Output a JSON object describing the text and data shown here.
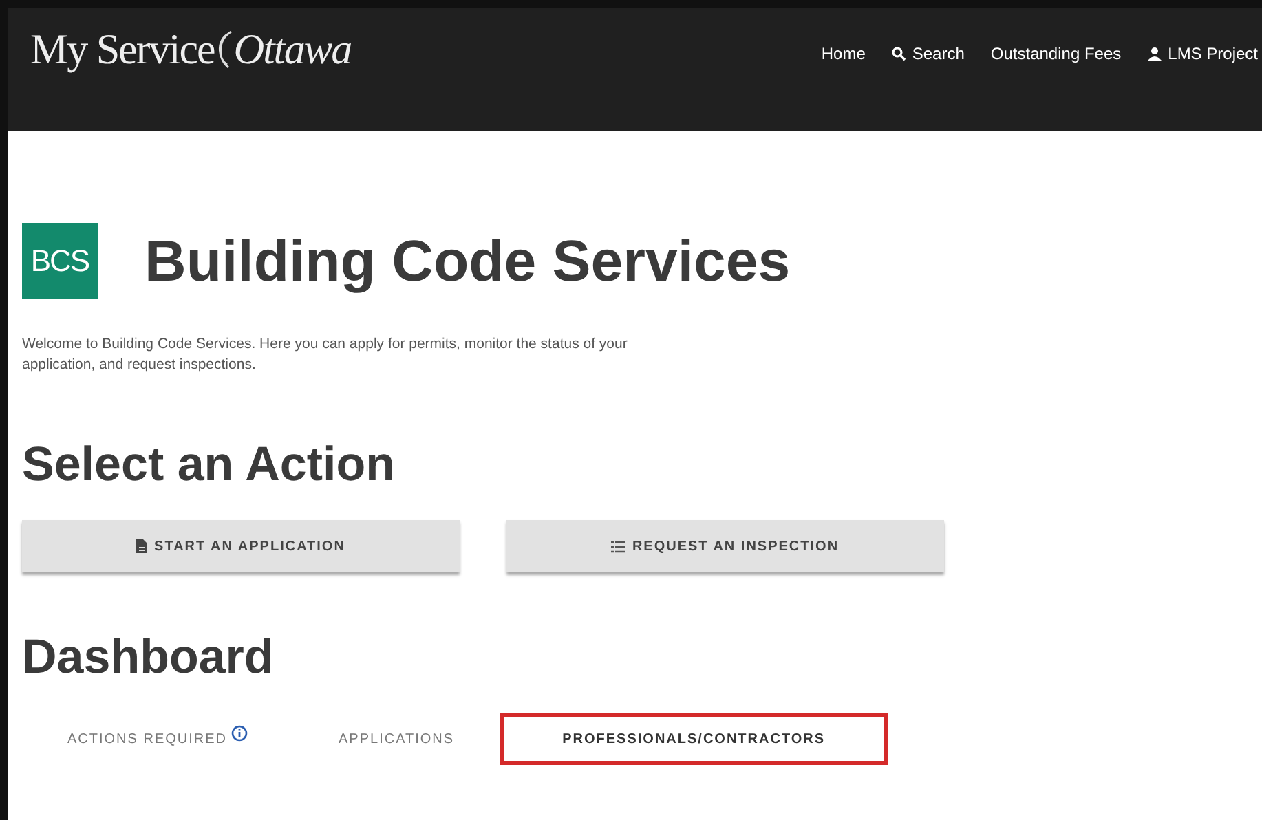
{
  "header": {
    "logo": "My Service",
    "logo_tail": "Ottawa",
    "nav": [
      {
        "label": "Home",
        "kind": "plain"
      },
      {
        "label": "Search",
        "kind": "search"
      },
      {
        "label": "Outstanding Fees",
        "kind": "plain"
      },
      {
        "label": "LMS Project",
        "kind": "user"
      }
    ]
  },
  "badge": "BCS",
  "title": "Building Code Services",
  "intro": "Welcome to Building Code Services. Here you can apply for permits, monitor the status of your application, and request inspections.",
  "actions_heading": "Select an Action",
  "actions": [
    {
      "label": "START AN APPLICATION",
      "kind": "document"
    },
    {
      "label": "REQUEST AN INSPECTION",
      "kind": "list"
    }
  ],
  "dashboard_heading": "Dashboard",
  "tabs": [
    {
      "label": "ACTIONS REQUIRED",
      "info": true,
      "selected": false
    },
    {
      "label": "APPLICATIONS",
      "info": false,
      "selected": false
    },
    {
      "label": "PROFESSIONALS/CONTRACTORS",
      "info": false,
      "selected": true
    }
  ]
}
